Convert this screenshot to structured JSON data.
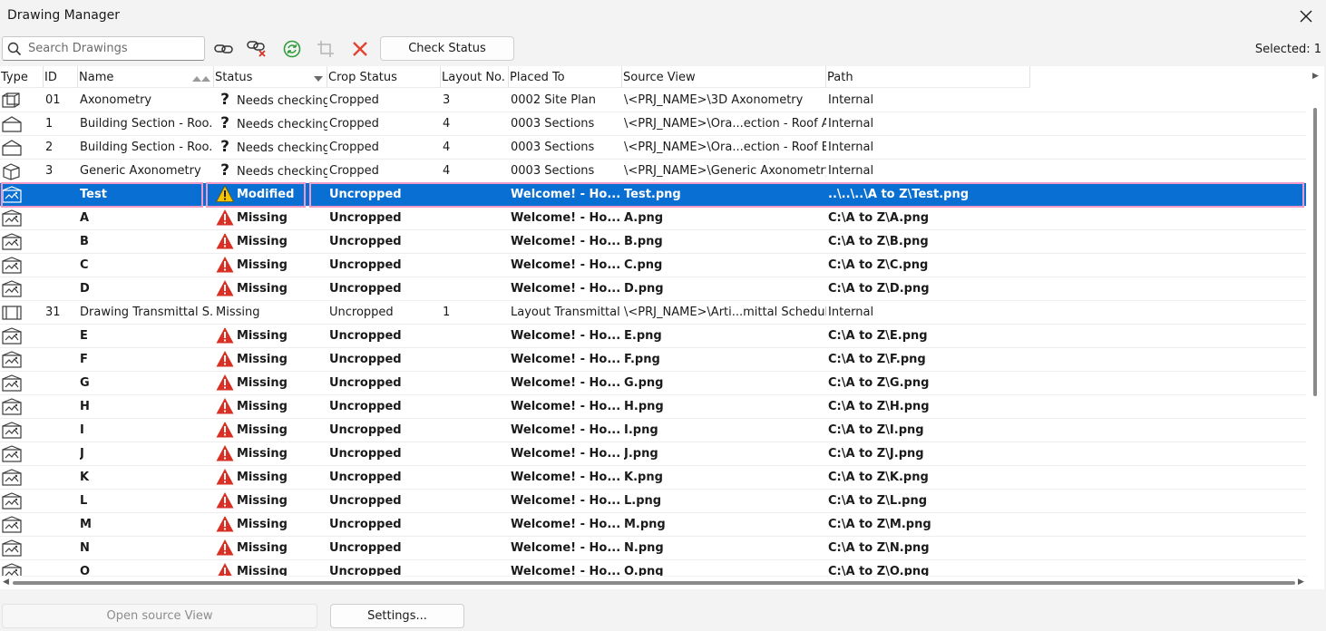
{
  "window": {
    "title": "Drawing Manager"
  },
  "toolbar": {
    "search_placeholder": "Search Drawings",
    "check_status_label": "Check Status",
    "selected_text": "Selected: 1"
  },
  "columns": [
    {
      "key": "type",
      "label": "Type"
    },
    {
      "key": "id",
      "label": "ID"
    },
    {
      "key": "name",
      "label": "Name"
    },
    {
      "key": "status",
      "label": "Status"
    },
    {
      "key": "crop",
      "label": "Crop Status"
    },
    {
      "key": "layout",
      "label": "Layout No."
    },
    {
      "key": "placed",
      "label": "Placed To"
    },
    {
      "key": "source",
      "label": "Source View"
    },
    {
      "key": "path",
      "label": "Path"
    }
  ],
  "rows": [
    {
      "type": "axon",
      "id": "01",
      "name": "Axonometry",
      "status_icon": "question",
      "status": "Needs checking",
      "crop": "Cropped",
      "layout": "3",
      "placed": "0002 Site Plan",
      "source": "\\<PRJ_NAME>\\3D Axonometry",
      "path": "Internal",
      "bold": false,
      "selected": false
    },
    {
      "type": "section",
      "id": "1",
      "name": "Building Section - Roo...",
      "status_icon": "question",
      "status": "Needs checking",
      "crop": "Cropped",
      "layout": "4",
      "placed": "0003 Sections",
      "source": "\\<PRJ_NAME>\\Ora...ection - Roof A",
      "path": "Internal",
      "bold": false,
      "selected": false
    },
    {
      "type": "section",
      "id": "2",
      "name": "Building Section - Roo...",
      "status_icon": "question",
      "status": "Needs checking",
      "crop": "Cropped",
      "layout": "4",
      "placed": "0003 Sections",
      "source": "\\<PRJ_NAME>\\Ora...ection - Roof B",
      "path": "Internal",
      "bold": false,
      "selected": false
    },
    {
      "type": "cube",
      "id": "3",
      "name": "Generic Axonometry",
      "status_icon": "question",
      "status": "Needs checking",
      "crop": "Cropped",
      "layout": "4",
      "placed": "0003 Sections",
      "source": "\\<PRJ_NAME>\\Generic Axonometry",
      "path": "Internal",
      "bold": false,
      "selected": false
    },
    {
      "type": "image",
      "id": "",
      "name": "Test",
      "status_icon": "warning-yellow",
      "status": "Modified",
      "crop": "Uncropped",
      "layout": "",
      "placed": "Welcome! - Ho...",
      "source": "Test.png",
      "path": "..\\..\\..\\A to Z\\Test.png",
      "bold": true,
      "selected": true
    },
    {
      "type": "image",
      "id": "",
      "name": "A",
      "status_icon": "warning-red",
      "status": "Missing",
      "crop": "Uncropped",
      "layout": "",
      "placed": "Welcome! - Ho...",
      "source": "A.png",
      "path": "C:\\A to Z\\A.png",
      "bold": true,
      "selected": false
    },
    {
      "type": "image",
      "id": "",
      "name": "B",
      "status_icon": "warning-red",
      "status": "Missing",
      "crop": "Uncropped",
      "layout": "",
      "placed": "Welcome! - Ho...",
      "source": "B.png",
      "path": "C:\\A to Z\\B.png",
      "bold": true,
      "selected": false
    },
    {
      "type": "image",
      "id": "",
      "name": "C",
      "status_icon": "warning-red",
      "status": "Missing",
      "crop": "Uncropped",
      "layout": "",
      "placed": "Welcome! - Ho...",
      "source": "C.png",
      "path": "C:\\A to Z\\C.png",
      "bold": true,
      "selected": false
    },
    {
      "type": "image",
      "id": "",
      "name": "D",
      "status_icon": "warning-red",
      "status": "Missing",
      "crop": "Uncropped",
      "layout": "",
      "placed": "Welcome! - Ho...",
      "source": "D.png",
      "path": "C:\\A to Z\\D.png",
      "bold": true,
      "selected": false
    },
    {
      "type": "schedule",
      "id": "31",
      "name": "Drawing Transmittal S...",
      "status_icon": "none",
      "status": "Missing",
      "crop": "Uncropped",
      "layout": "1",
      "placed": "Layout Transmittal",
      "source": "\\<PRJ_NAME>\\Arti...mittal Schedule",
      "path": "Internal",
      "bold": false,
      "selected": false
    },
    {
      "type": "image",
      "id": "",
      "name": "E",
      "status_icon": "warning-red",
      "status": "Missing",
      "crop": "Uncropped",
      "layout": "",
      "placed": "Welcome! - Ho...",
      "source": "E.png",
      "path": "C:\\A to Z\\E.png",
      "bold": true,
      "selected": false
    },
    {
      "type": "image",
      "id": "",
      "name": "F",
      "status_icon": "warning-red",
      "status": "Missing",
      "crop": "Uncropped",
      "layout": "",
      "placed": "Welcome! - Ho...",
      "source": "F.png",
      "path": "C:\\A to Z\\F.png",
      "bold": true,
      "selected": false
    },
    {
      "type": "image",
      "id": "",
      "name": "G",
      "status_icon": "warning-red",
      "status": "Missing",
      "crop": "Uncropped",
      "layout": "",
      "placed": "Welcome! - Ho...",
      "source": "G.png",
      "path": "C:\\A to Z\\G.png",
      "bold": true,
      "selected": false
    },
    {
      "type": "image",
      "id": "",
      "name": "H",
      "status_icon": "warning-red",
      "status": "Missing",
      "crop": "Uncropped",
      "layout": "",
      "placed": "Welcome! - Ho...",
      "source": "H.png",
      "path": "C:\\A to Z\\H.png",
      "bold": true,
      "selected": false
    },
    {
      "type": "image",
      "id": "",
      "name": "I",
      "status_icon": "warning-red",
      "status": "Missing",
      "crop": "Uncropped",
      "layout": "",
      "placed": "Welcome! - Ho...",
      "source": "I.png",
      "path": "C:\\A to Z\\I.png",
      "bold": true,
      "selected": false
    },
    {
      "type": "image",
      "id": "",
      "name": "J",
      "status_icon": "warning-red",
      "status": "Missing",
      "crop": "Uncropped",
      "layout": "",
      "placed": "Welcome! - Ho...",
      "source": "J.png",
      "path": "C:\\A to Z\\J.png",
      "bold": true,
      "selected": false
    },
    {
      "type": "image",
      "id": "",
      "name": "K",
      "status_icon": "warning-red",
      "status": "Missing",
      "crop": "Uncropped",
      "layout": "",
      "placed": "Welcome! - Ho...",
      "source": "K.png",
      "path": "C:\\A to Z\\K.png",
      "bold": true,
      "selected": false
    },
    {
      "type": "image",
      "id": "",
      "name": "L",
      "status_icon": "warning-red",
      "status": "Missing",
      "crop": "Uncropped",
      "layout": "",
      "placed": "Welcome! - Ho...",
      "source": "L.png",
      "path": "C:\\A to Z\\L.png",
      "bold": true,
      "selected": false
    },
    {
      "type": "image",
      "id": "",
      "name": "M",
      "status_icon": "warning-red",
      "status": "Missing",
      "crop": "Uncropped",
      "layout": "",
      "placed": "Welcome! - Ho...",
      "source": "M.png",
      "path": "C:\\A to Z\\M.png",
      "bold": true,
      "selected": false
    },
    {
      "type": "image",
      "id": "",
      "name": "N",
      "status_icon": "warning-red",
      "status": "Missing",
      "crop": "Uncropped",
      "layout": "",
      "placed": "Welcome! - Ho...",
      "source": "N.png",
      "path": "C:\\A to Z\\N.png",
      "bold": true,
      "selected": false
    },
    {
      "type": "image",
      "id": "",
      "name": "O",
      "status_icon": "warning-red",
      "status": "Missing",
      "crop": "Uncropped",
      "layout": "",
      "placed": "Welcome! - Ho...",
      "source": "O.png",
      "path": "C:\\A to Z\\O.png",
      "bold": true,
      "selected": false
    }
  ],
  "footer": {
    "open_source_label": "Open source View",
    "settings_label": "Settings..."
  },
  "colors": {
    "selection": "#0a6fd2",
    "selection_highlight": "#ef9ac7",
    "warning_red": "#d93025",
    "warning_yellow": "#f5c400",
    "refresh_green": "#2e9e3a",
    "delete_red": "#e0442f"
  }
}
